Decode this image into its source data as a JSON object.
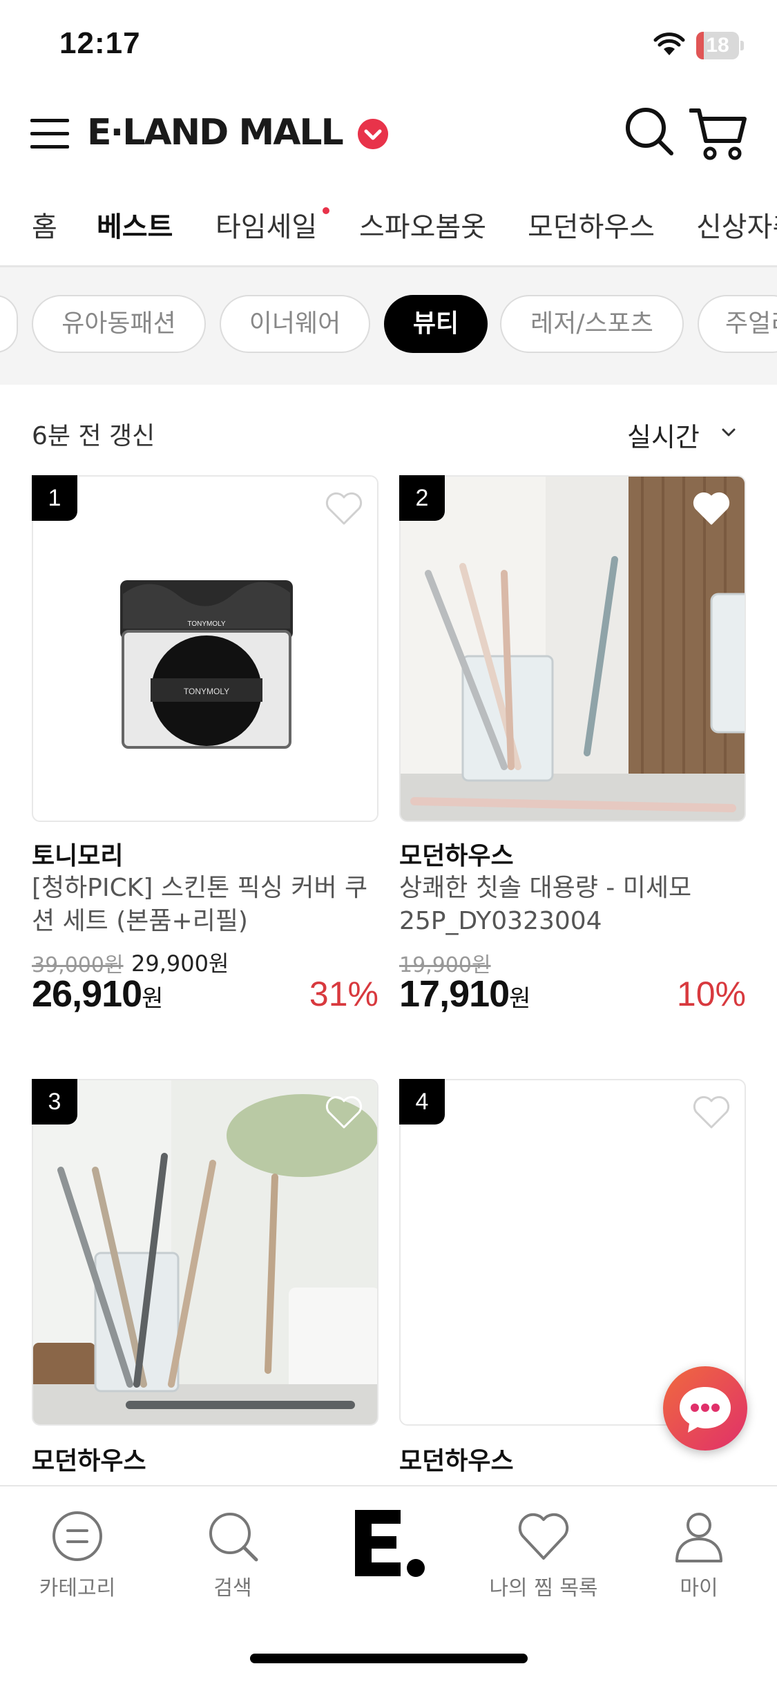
{
  "status_bar": {
    "time": "12:17",
    "battery": "18",
    "battery_level": 0.18
  },
  "header": {
    "logo": "E·LAND MALL"
  },
  "tabs": [
    {
      "label": "홈"
    },
    {
      "label": "베스트"
    },
    {
      "label": "타임세일"
    },
    {
      "label": "스파오봄옷"
    },
    {
      "label": "모던하우스"
    },
    {
      "label": "신상자취"
    }
  ],
  "chips": [
    {
      "label": "유아동패션"
    },
    {
      "label": "이너웨어"
    },
    {
      "label": "뷰티"
    },
    {
      "label": "레저/스포츠"
    },
    {
      "label": "주얼리"
    }
  ],
  "list_meta": {
    "updated": "6분 전 갱신",
    "sort": "실시간"
  },
  "products": [
    {
      "rank": "1",
      "brand": "토니모리",
      "name": "[청하PICK] 스킨톤 픽싱 커버 쿠션 세트 (본품+리필)",
      "original_price": "39,000원",
      "sale_price": "29,900원",
      "final_price": "26,910",
      "currency": "원",
      "discount": "31%",
      "liked": false
    },
    {
      "rank": "2",
      "brand": "모던하우스",
      "name": "상쾌한 칫솔 대용량 - 미세모 25P_DY0323004",
      "original_price": "19,900원",
      "sale_price": "",
      "final_price": "17,910",
      "currency": "원",
      "discount": "10%",
      "liked": false
    },
    {
      "rank": "3",
      "brand": "모던하우스",
      "name": "",
      "liked": false
    },
    {
      "rank": "4",
      "brand": "모던하우스",
      "name": "",
      "liked": false
    }
  ],
  "bottom_nav": [
    {
      "label": "카테고리",
      "icon": "category-icon"
    },
    {
      "label": "검색",
      "icon": "search-icon"
    },
    {
      "label": "",
      "icon": "home-logo-icon"
    },
    {
      "label": "나의 찜 목록",
      "icon": "heart-icon"
    },
    {
      "label": "마이",
      "icon": "person-icon"
    }
  ],
  "colors": {
    "accent": "#e8334a",
    "discount": "#d8393e",
    "active_chip": "#000000"
  }
}
